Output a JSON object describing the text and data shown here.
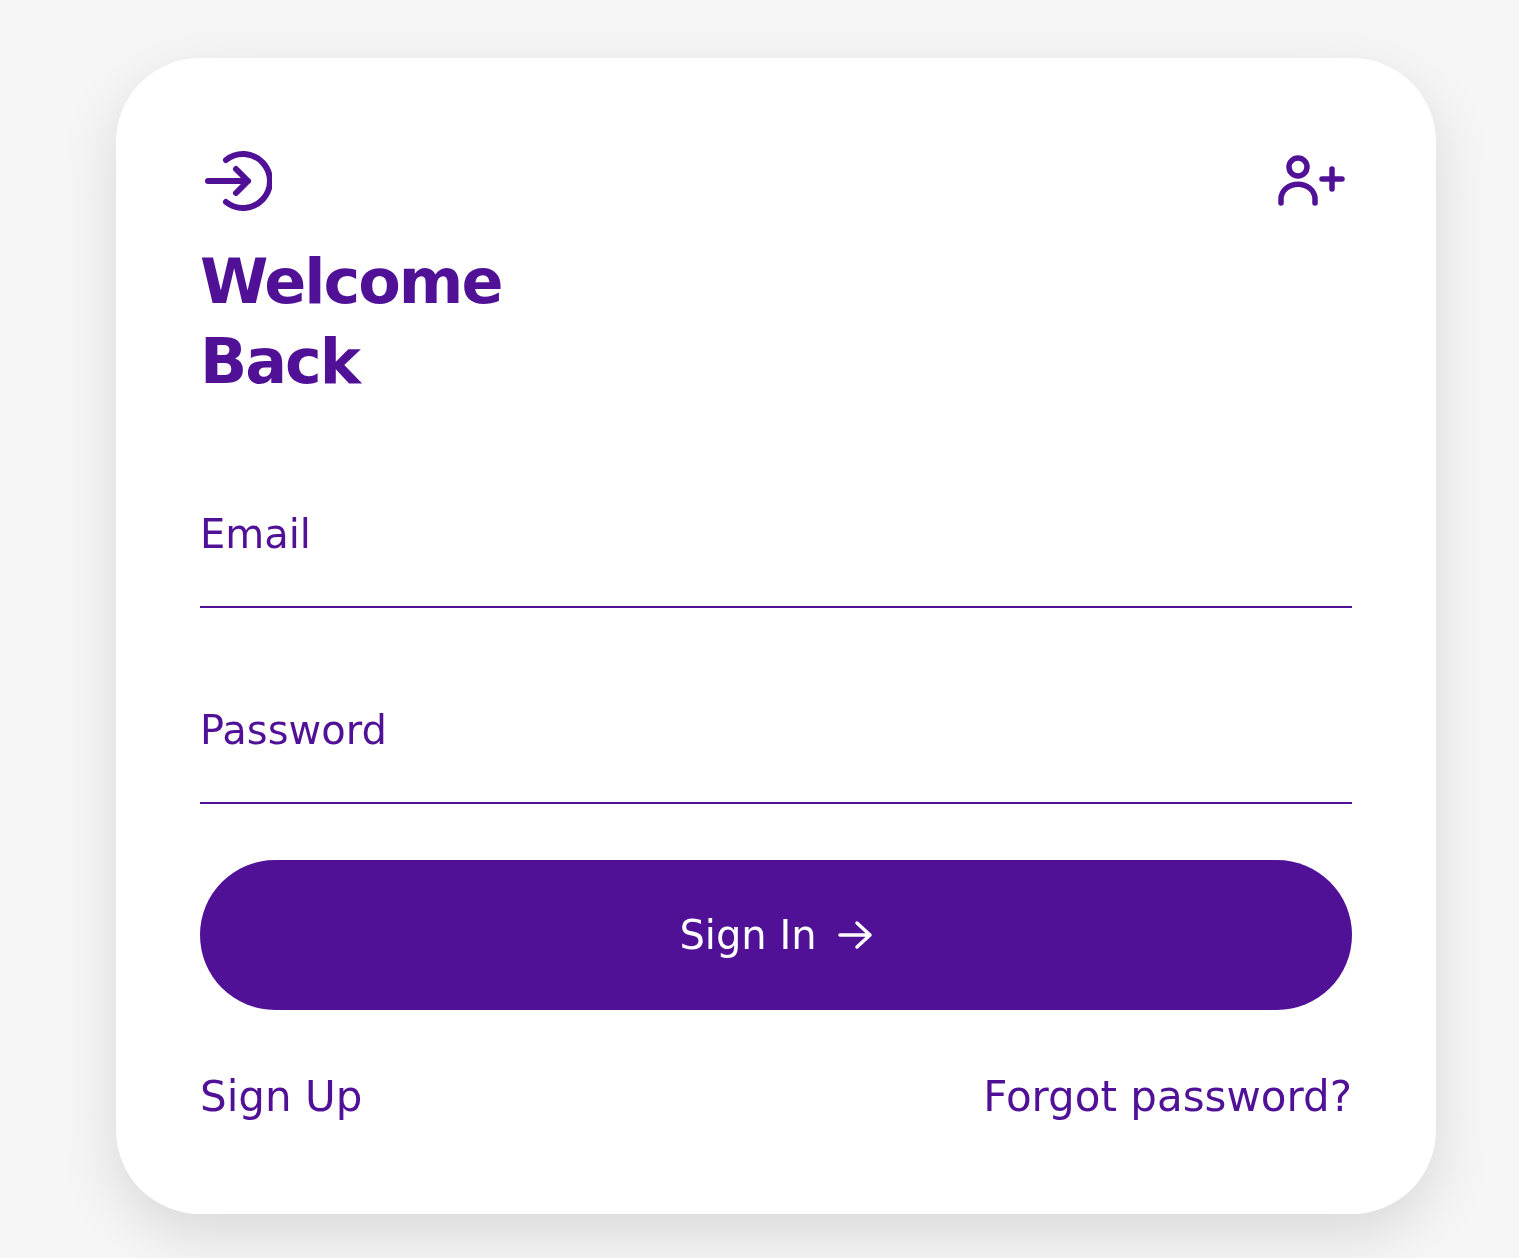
{
  "title": "Welcome Back",
  "fields": [
    {
      "placeholder": "Email"
    },
    {
      "placeholder": "Password"
    }
  ],
  "submit": {
    "label": "Sign In"
  },
  "links": [
    {
      "label": "Sign Up"
    },
    {
      "label": "Forgot password?"
    }
  ]
}
